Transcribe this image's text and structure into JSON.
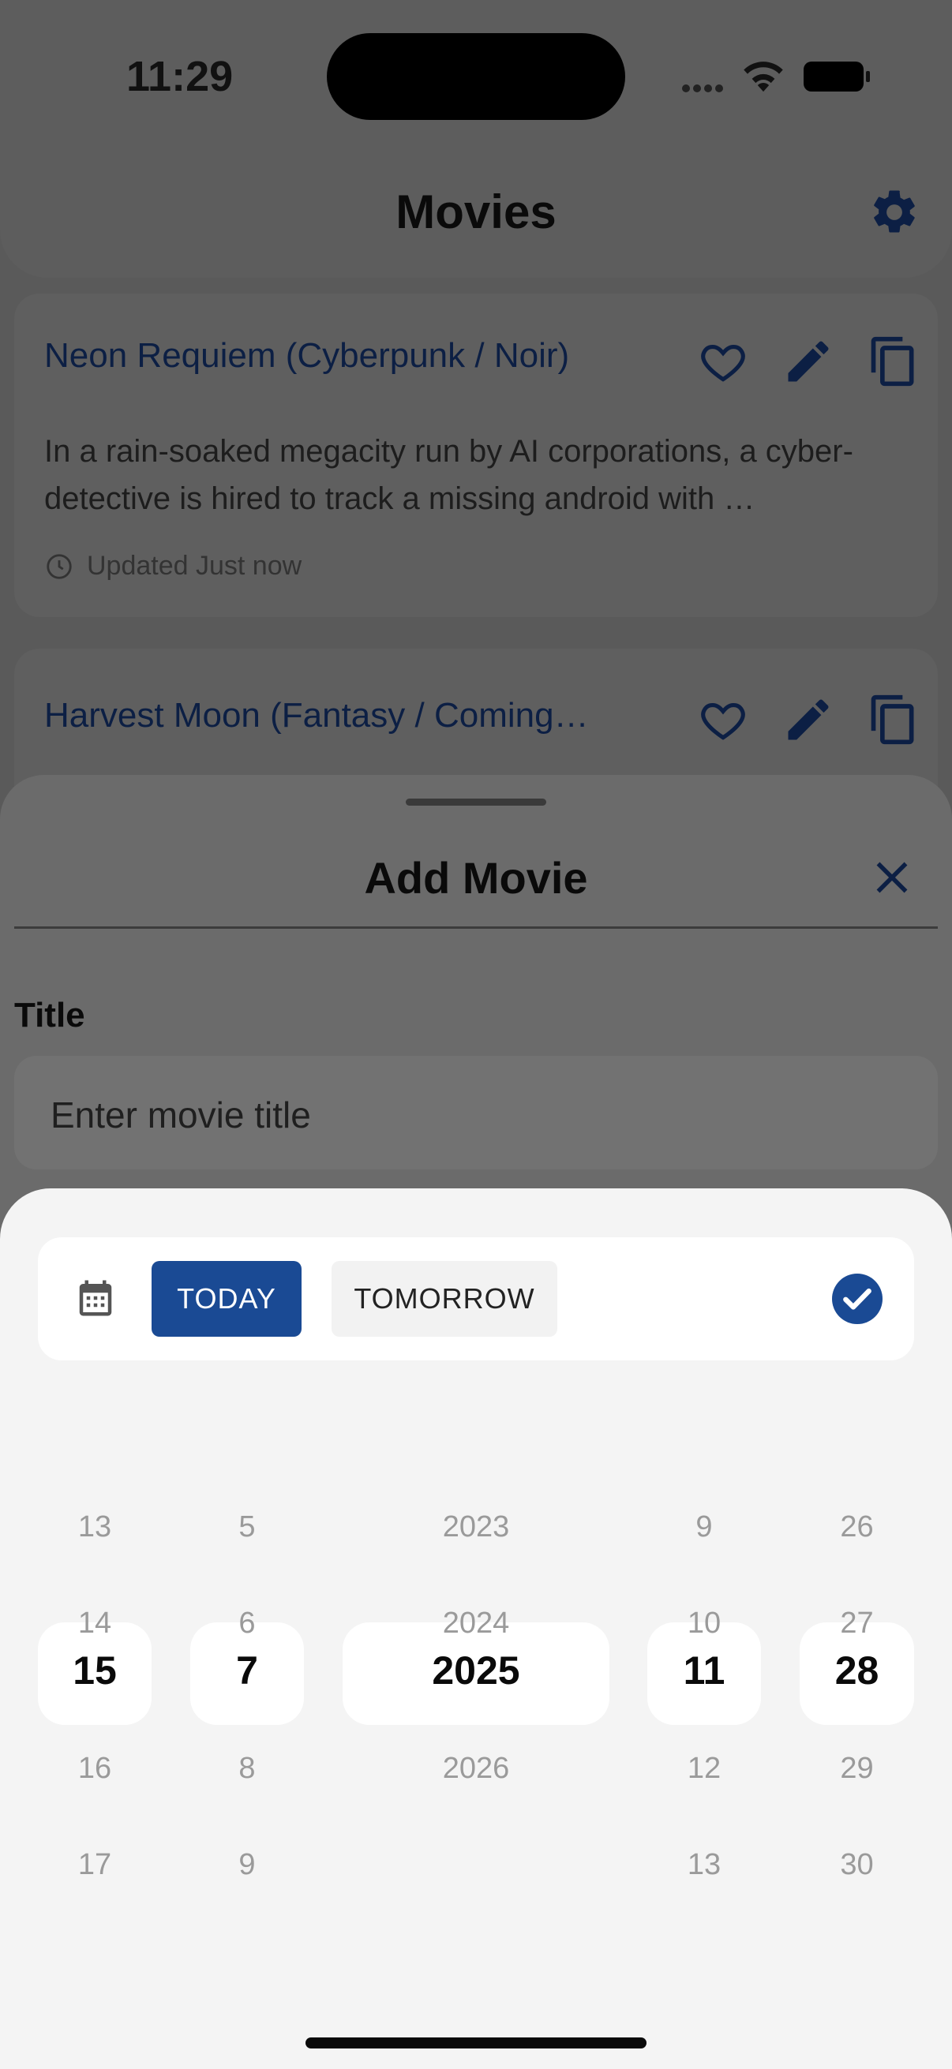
{
  "status_bar": {
    "time": "11:29"
  },
  "header": {
    "title": "Movies"
  },
  "movies": [
    {
      "title": "Neon Requiem (Cyberpunk / Noir)",
      "description": "In a rain-soaked megacity run by AI corporations, a cyber-detective is hired to track a missing android with …",
      "updated": "Updated Just now"
    },
    {
      "title": "Harvest Moon (Fantasy / Coming…"
    }
  ],
  "sheet": {
    "title": "Add Movie",
    "title_label": "Title",
    "title_placeholder": "Enter movie title"
  },
  "date_picker": {
    "today_label": "TODAY",
    "tomorrow_label": "TOMORROW",
    "columns": [
      {
        "name": "hour",
        "items": [
          "13",
          "14",
          "15",
          "16",
          "17"
        ],
        "selected": "15"
      },
      {
        "name": "minute",
        "items": [
          "5",
          "6",
          "7",
          "8",
          "9"
        ],
        "selected": "7"
      },
      {
        "name": "year",
        "items": [
          "2023",
          "2024",
          "2025",
          "2026",
          ""
        ],
        "selected": "2025"
      },
      {
        "name": "month",
        "items": [
          "9",
          "10",
          "11",
          "12",
          "13"
        ],
        "selected": "11"
      },
      {
        "name": "day",
        "items": [
          "26",
          "27",
          "28",
          "29",
          "30"
        ],
        "selected": "28"
      }
    ]
  },
  "colors": {
    "accent": "#1a4a94",
    "card_title": "#0c1f44",
    "picker_background": "#f4f4f4"
  }
}
